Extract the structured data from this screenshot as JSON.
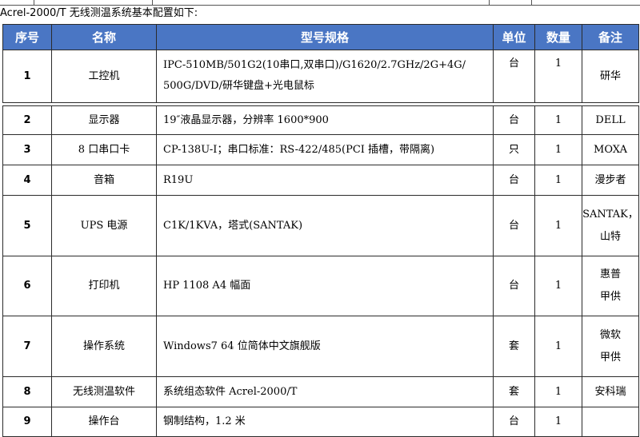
{
  "intro": "Acrel-2000/T 无线测温系统基本配置如下:",
  "headers": {
    "no": "序号",
    "name": "名称",
    "spec": "型号规格",
    "unit": "单位",
    "qty": "数量",
    "note": "备注"
  },
  "rows": [
    {
      "no": "1",
      "name": "工控机",
      "spec_lines": [
        "IPC-510MB/501G2(10串口,双串口)/G1620/2.7GHz/2G+4G/",
        "500G/DVD/研华键盘+光电鼠标"
      ],
      "unit": "台",
      "qty": "1",
      "note_lines": [
        "研华"
      ]
    },
    {
      "no": "2",
      "name": "显示器",
      "spec_lines": [
        "19″液晶显示器，分辨率 1600*900"
      ],
      "unit": "台",
      "qty": "1",
      "note_lines": [
        "DELL"
      ]
    },
    {
      "no": "3",
      "name": "8 口串口卡",
      "spec_lines": [
        "CP-138U-I；串口标准：RS-422/485(PCI 插槽，带隔离)"
      ],
      "unit": "只",
      "qty": "1",
      "note_lines": [
        "MOXA"
      ]
    },
    {
      "no": "4",
      "name": "音箱",
      "spec_lines": [
        "R19U"
      ],
      "unit": "台",
      "qty": "1",
      "note_lines": [
        "漫步者"
      ]
    },
    {
      "no": "5",
      "name": "UPS 电源",
      "spec_lines": [
        "C1K/1KVA，塔式(SANTAK)"
      ],
      "unit": "台",
      "qty": "1",
      "note_lines": [
        "SANTAK，",
        "山特"
      ]
    },
    {
      "no": "6",
      "name": "打印机",
      "spec_lines": [
        "HP  1108  A4 幅面"
      ],
      "unit": "台",
      "qty": "1",
      "note_lines": [
        "惠普",
        "甲供"
      ]
    },
    {
      "no": "7",
      "name": "操作系统",
      "spec_lines": [
        "Windows7  64 位简体中文旗舰版"
      ],
      "unit": "套",
      "qty": "1",
      "note_lines": [
        "微软",
        "甲供"
      ]
    },
    {
      "no": "8",
      "name": "无线测温软件",
      "spec_lines": [
        "系统组态软件 Acrel-2000/T"
      ],
      "unit": "套",
      "qty": "1",
      "note_lines": [
        "安科瑞"
      ]
    },
    {
      "no": "9",
      "name": "操作台",
      "spec_lines": [
        "钢制结构，1.2 米"
      ],
      "unit": "台",
      "qty": "1",
      "note_lines": [
        ""
      ]
    }
  ]
}
